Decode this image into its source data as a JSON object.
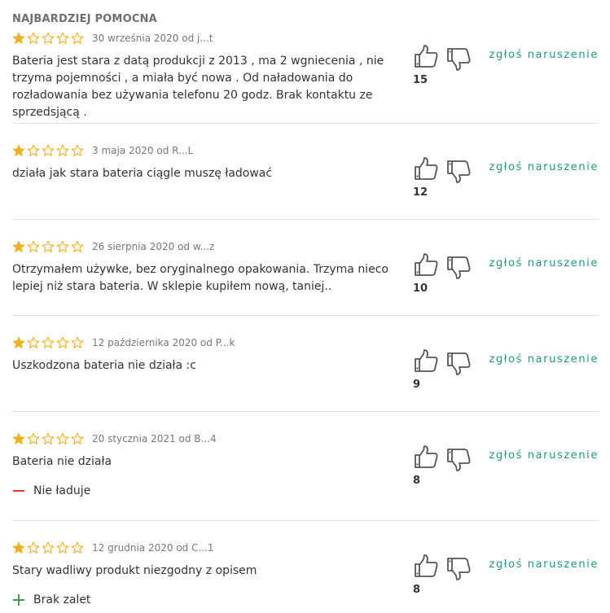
{
  "section_title": "NAJBARDZIEJ POMOCNA",
  "colors": {
    "star": "#f2b01e",
    "accent": "#1b9b79",
    "minus": "#d6402b",
    "plus": "#3aa047"
  },
  "report_label": "zgłoś naruszenie",
  "reviews": [
    {
      "rating": 1,
      "date": "30 września 2020 od j...t",
      "text": "Bateria jest stara z datą produkcji z 2013 , ma 2 wgniecenia , nie trzyma pojemności , a miała być nowa . Od naładowania do rozładowania bez używania telefonu 20 godz. Brak kontaktu ze sprzedsjącą .",
      "helpful": "15"
    },
    {
      "rating": 1,
      "date": "3 maja 2020 od R...L",
      "text": "działa jak stara bateria ciągle muszę ładować",
      "helpful": "12"
    },
    {
      "rating": 1,
      "date": "26 sierpnia 2020 od w...z",
      "text": "Otrzymałem używke, bez oryginalnego opakowania. Trzyma nieco lepiej niż stara bateria. W sklepie kupiłem nową, taniej..",
      "helpful": "10"
    },
    {
      "rating": 1,
      "date": "12 października 2020 od P...k",
      "text": "Uszkodzona bateria nie działa :c",
      "helpful": "9"
    },
    {
      "rating": 1,
      "date": "20 stycznia 2021 od B...4",
      "text": "Bateria nie działa",
      "cons": "Nie ładuje",
      "helpful": "8"
    },
    {
      "rating": 1,
      "date": "12 grudnia 2020 od C...1",
      "text": "Stary wadliwy produkt niezgodny z opisem",
      "pros": "Brak zalet",
      "helpful": "8"
    }
  ]
}
